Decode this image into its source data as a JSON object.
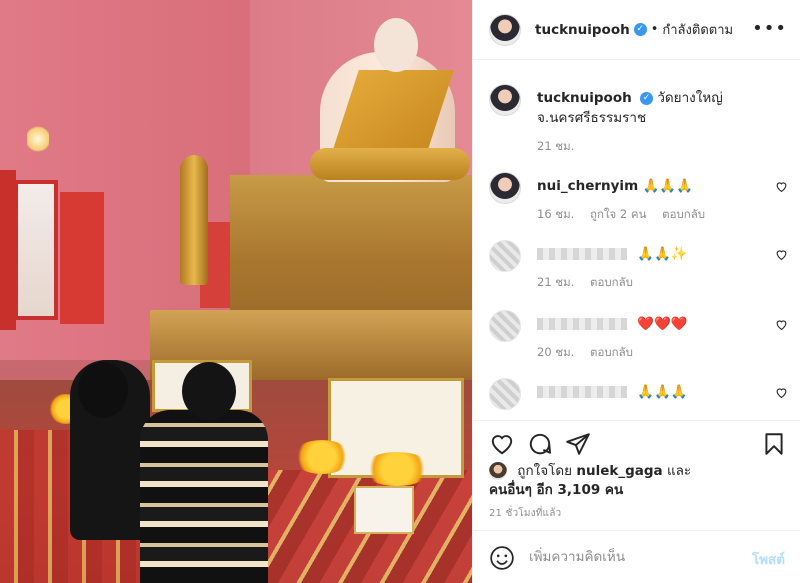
{
  "header": {
    "username": "tucknuipooh",
    "separator": "•",
    "follow_status": "กำลังติดตาม",
    "more_label": "•••"
  },
  "caption": {
    "username": "tucknuipooh",
    "text_line1": "วัดยางใหญ่",
    "text_line2": "จ.นครศรีธรรมราช",
    "time": "21 ชม."
  },
  "comments": [
    {
      "username": "nui_chernyim",
      "text": "🙏🙏🙏",
      "time": "16 ชม.",
      "likes": "ถูกใจ 2 คน",
      "reply": "ตอบกลับ"
    },
    {
      "username": "",
      "text": "🙏🙏✨",
      "time": "21 ชม.",
      "likes": "",
      "reply": "ตอบกลับ"
    },
    {
      "username": "",
      "text": "❤️❤️❤️",
      "time": "20 ชม.",
      "likes": "",
      "reply": "ตอบกลับ"
    },
    {
      "username": "",
      "text": "🙏🙏🙏",
      "time": "",
      "likes": "",
      "reply": ""
    }
  ],
  "likes": {
    "prefix": "ถูกใจโดย",
    "first_liker": "nulek_gaga",
    "joiner": "และ",
    "others": "คนอื่นๆ อีก 3,109 คน"
  },
  "timestamp": "21 ชั่วโมงที่แล้ว",
  "composer": {
    "placeholder": "เพิ่มความคิดเห็น",
    "post_label": "โพสต์"
  },
  "icons": {
    "verified": "verified-badge-icon",
    "like": "heart-icon",
    "comment": "comment-icon",
    "share": "share-icon",
    "save": "bookmark-icon",
    "emoji": "emoji-icon"
  },
  "colors": {
    "verified": "#3897f0",
    "muted_text": "#8e8e8e",
    "post_button_disabled": "#b2dffc",
    "heart_emoji": "#e0245e"
  }
}
